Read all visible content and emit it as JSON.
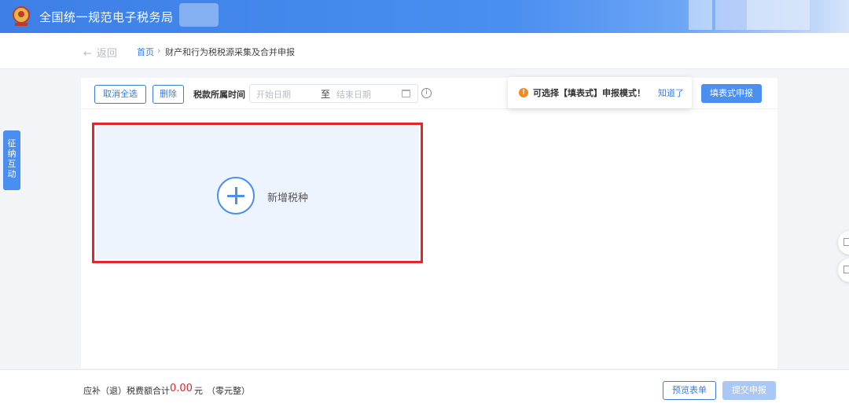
{
  "header": {
    "title": "全国统一规范电子税务局",
    "emblem_icon": "national-emblem-icon",
    "colors": {
      "bar": "#3d7fe6"
    }
  },
  "breadcrumb": {
    "back_label": "返回",
    "back_icon": "arrow-left-icon",
    "home": "首页",
    "separator": "›",
    "current": "财产和行为税税源采集及合并申报"
  },
  "side_tab": {
    "label": "征纳互动"
  },
  "toolbar": {
    "cancel_select_all": "取消全选",
    "delete": "删除",
    "period_label": "税款所属时间",
    "date_start_placeholder": "开始日期",
    "date_to": "至",
    "date_end_placeholder": "结束日期",
    "info_icon": "info-circle-icon",
    "calendar_icon": "calendar-icon"
  },
  "tooltip": {
    "icon": "warning-circle-icon",
    "message": "可选择【填表式】申报模式！",
    "ack": "知道了"
  },
  "form_mode_button": "填表式申报",
  "add_tax": {
    "label": "新增税种",
    "icon": "plus-circle-icon"
  },
  "footer": {
    "sum_label": "应补（退）税费额合计",
    "amount": "0.00",
    "unit": "元",
    "amount_words": "（零元整）",
    "preview_button": "预览表单",
    "submit_button": "提交申报"
  },
  "colors": {
    "accent": "#3a7be0",
    "highlight_border": "#e3262d",
    "amount": "#e3262d",
    "warning": "#f08a24"
  }
}
